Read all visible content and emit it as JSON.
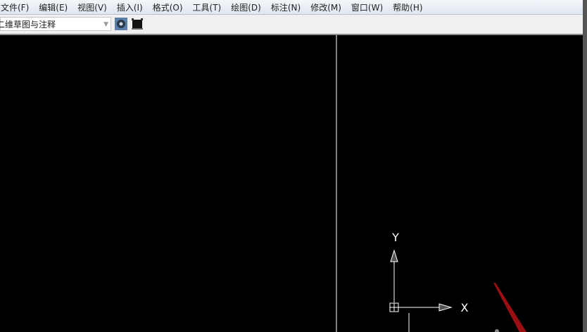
{
  "menu": [
    "文件(F)",
    "编辑(E)",
    "视图(V)",
    "插入(I)",
    "格式(O)",
    "工具(T)",
    "绘图(D)",
    "标注(N)",
    "修改(M)",
    "窗口(W)",
    "帮助(H)"
  ],
  "workspace": {
    "value": "二维草图与注释"
  },
  "ucs": {
    "x_label": "X",
    "y_label": "Y"
  },
  "colors": {
    "canvas": "#000000",
    "pointer": "#9b0f14"
  }
}
